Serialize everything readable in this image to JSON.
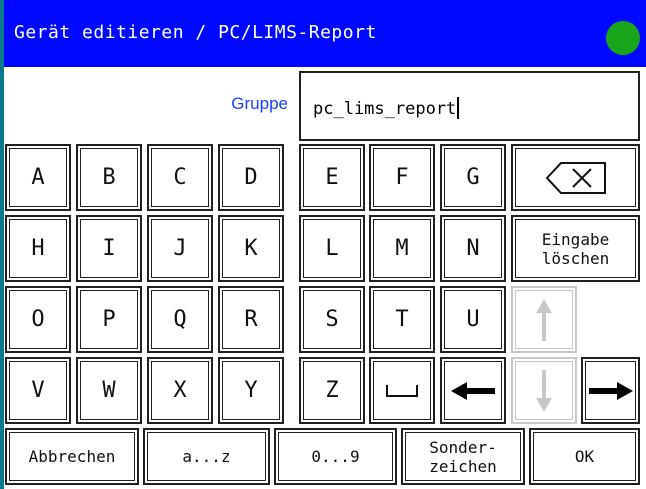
{
  "window": {
    "title": "Gerät editieren / PC/LIMS-Report",
    "status_color": "#1aa61a",
    "accent": "#0008ff"
  },
  "field": {
    "label": "Gruppe",
    "value": "pc_lims_report"
  },
  "keys": {
    "row1": [
      "A",
      "B",
      "C",
      "D",
      "E",
      "F",
      "G"
    ],
    "row2": [
      "H",
      "I",
      "J",
      "K",
      "L",
      "M",
      "N"
    ],
    "row3": [
      "O",
      "P",
      "Q",
      "R",
      "S",
      "T",
      "U"
    ],
    "row4": [
      "V",
      "W",
      "X",
      "Y",
      "Z"
    ],
    "space": "␣",
    "clear_label": "Eingabe löschen",
    "icons": {
      "backspace": "backspace-icon",
      "up": "arrow-up-icon",
      "down": "arrow-down-icon",
      "left": "arrow-left-icon",
      "right": "arrow-right-icon"
    }
  },
  "bottom": {
    "cancel": "Abbrechen",
    "letters": "a...z",
    "digits": "0...9",
    "special": "Sonder-zeichen",
    "ok": "OK"
  }
}
